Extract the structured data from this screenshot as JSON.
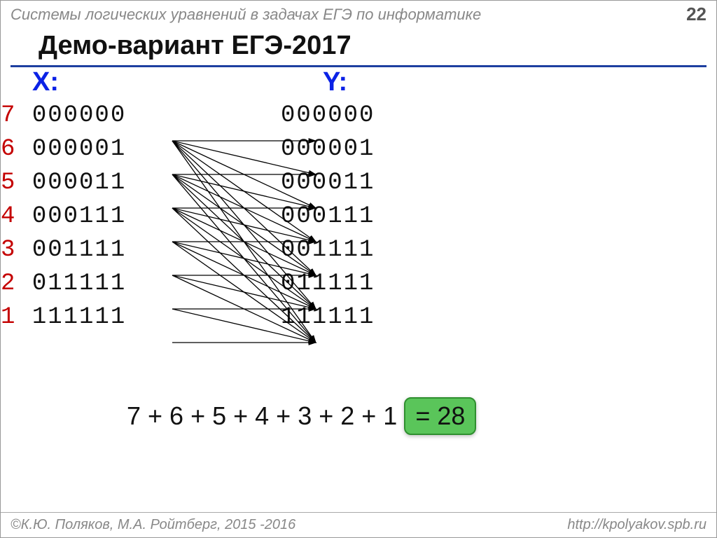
{
  "header": {
    "topic": "Системы логических уравнений в задачах ЕГЭ по информатике",
    "page": "22"
  },
  "title": "Демо-вариант ЕГЭ-2017",
  "columns": {
    "x_label": "X:",
    "y_label": "Y:"
  },
  "rows": [
    {
      "idx": "7",
      "x": "000000",
      "y": "000000"
    },
    {
      "idx": "6",
      "x": "000001",
      "y": "000001"
    },
    {
      "idx": "5",
      "x": "000011",
      "y": "000011"
    },
    {
      "idx": "4",
      "x": "000111",
      "y": "000111"
    },
    {
      "idx": "3",
      "x": "001111",
      "y": "001111"
    },
    {
      "idx": "2",
      "x": "011111",
      "y": "011111"
    },
    {
      "idx": "1",
      "x": "111111",
      "y": "111111"
    }
  ],
  "arrow_map": [
    [
      0,
      1,
      2,
      3,
      4,
      5,
      6
    ],
    [
      1,
      2,
      3,
      4,
      5,
      6
    ],
    [
      2,
      3,
      4,
      5,
      6
    ],
    [
      3,
      4,
      5,
      6
    ],
    [
      4,
      5,
      6
    ],
    [
      5,
      6
    ],
    [
      6
    ]
  ],
  "sum": {
    "expression": "7 + 6 + 5 + 4 + 3 + 2 + 1",
    "result": "= 28"
  },
  "footer": {
    "left": "©К.Ю. Поляков, М.А. Ройтберг, 2015 -2016",
    "right": "http://kpolyakov.spb.ru"
  },
  "layout": {
    "xColLeft": 60,
    "yColLeft": 460,
    "rowTop0": 175,
    "rowStep": 48,
    "xEndPx": 245,
    "yStartPx": 450,
    "arrowYOffset": 20
  }
}
